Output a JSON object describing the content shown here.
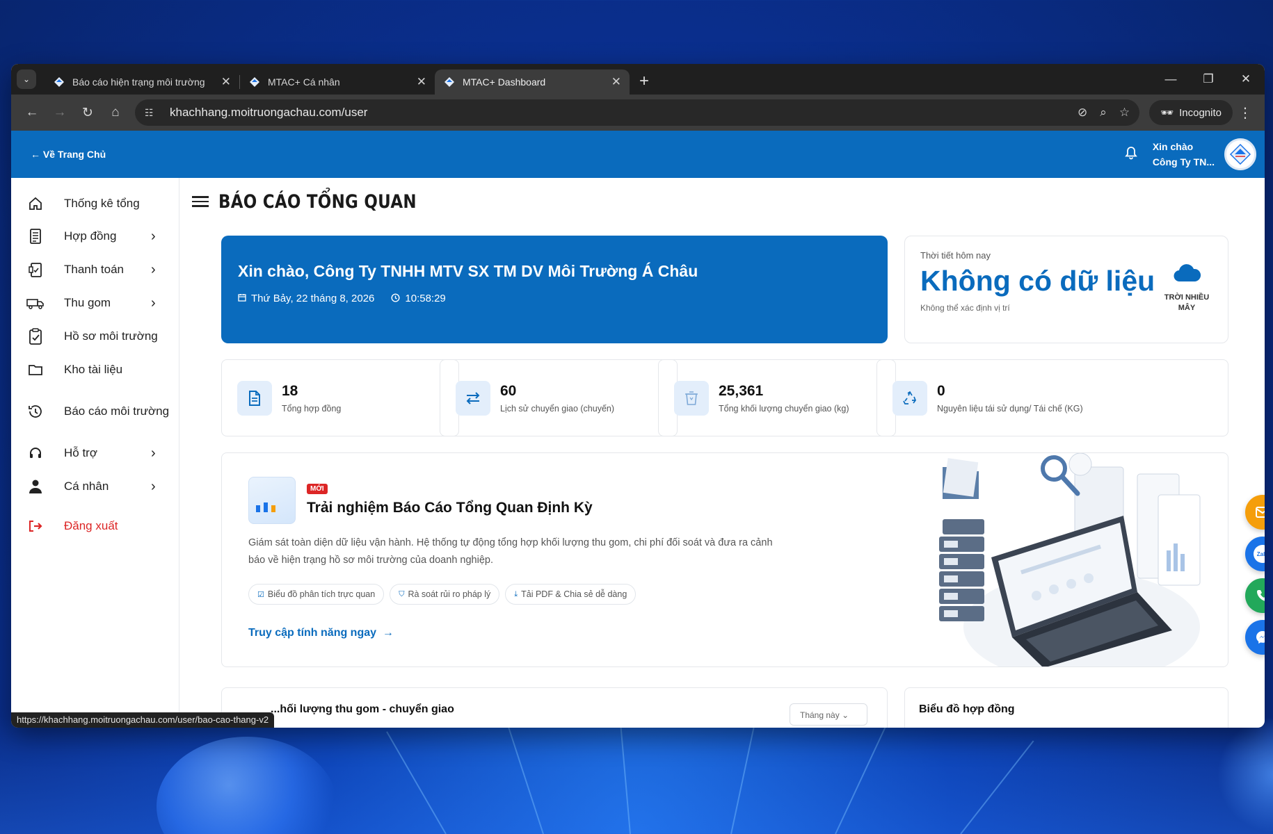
{
  "browser": {
    "tabs": [
      {
        "title": "Báo cáo hiện trạng môi trường",
        "active": false
      },
      {
        "title": "MTAC+ Cá nhân",
        "active": false
      },
      {
        "title": "MTAC+ Dashboard",
        "active": true
      }
    ],
    "url": "khachhang.moitruongachau.com/user",
    "incognito_label": "Incognito",
    "status_url": "https://khachhang.moitruongachau.com/user/bao-cao-thang-v2"
  },
  "header": {
    "back_label": "← Về Trang Chủ",
    "greeting_line1": "Xin chào",
    "greeting_line2": "Công Ty TN..."
  },
  "sidebar": {
    "items": [
      {
        "label": "Thống kê tổng",
        "icon": "home-icon",
        "has_chevron": false
      },
      {
        "label": "Hợp đồng",
        "icon": "document-icon",
        "has_chevron": true
      },
      {
        "label": "Thanh toán",
        "icon": "payment-icon",
        "has_chevron": true
      },
      {
        "label": "Thu gom",
        "icon": "truck-icon",
        "has_chevron": true
      },
      {
        "label": "Hồ sơ môi trường",
        "icon": "clipboard-check-icon",
        "has_chevron": false
      },
      {
        "label": "Kho tài liệu",
        "icon": "folder-icon",
        "has_chevron": false
      },
      {
        "label": "Báo cáo môi trường",
        "icon": "history-icon",
        "has_chevron": false
      },
      {
        "label": "Hỗ trợ",
        "icon": "headset-icon",
        "has_chevron": true
      },
      {
        "label": "Cá nhân",
        "icon": "user-icon",
        "has_chevron": true
      },
      {
        "label": "Đăng xuất",
        "icon": "logout-icon",
        "has_chevron": false
      }
    ]
  },
  "page": {
    "title": "BÁO CÁO TỔNG QUAN"
  },
  "hero": {
    "greeting": "Xin chào, Công Ty TNHH MTV SX TM DV Môi Trường Á Châu",
    "date": "Thứ Bảy, 22 tháng 8, 2026",
    "time": "10:58:29"
  },
  "weather": {
    "label": "Thời tiết hôm nay",
    "value": "Không có dữ liệu",
    "subtext": "Không thể xác định vị trí",
    "condition": "TRỜI NHIỀU MÂY"
  },
  "stats": [
    {
      "value": "18",
      "label": "Tổng hợp đồng",
      "icon": "file-icon"
    },
    {
      "value": "60",
      "label": "Lịch sử chuyển giao (chuyến)",
      "icon": "transfer-icon"
    },
    {
      "value": "25,361",
      "label": "Tổng khối lượng chuyển giao (kg)",
      "icon": "waste-bin-icon"
    },
    {
      "value": "0",
      "label": "Nguyên liệu tái sử dụng/ Tái chế (KG)",
      "icon": "recycle-icon"
    }
  ],
  "promo": {
    "badge": "MỚI",
    "title": "Trải nghiệm Báo Cáo Tổng Quan Định Kỳ",
    "description": "Giám sát toàn diện dữ liệu vận hành. Hệ thống tự động tổng hợp khối lượng thu gom, chi phí đối soát và đưa ra cảnh báo về hiện trạng hồ sơ môi trường của doanh nghiệp.",
    "chips": [
      "Biểu đồ phân tích trực quan",
      "Rà soát rủi ro pháp lý",
      "Tải PDF & Chia sẻ dễ dàng"
    ],
    "cta": "Truy cập tính năng ngay"
  },
  "bottom": {
    "left_title": "...hối lượng thu gom - chuyển giao",
    "left_select": "Tháng này",
    "right_title": "Biểu đồ hợp đồng"
  },
  "colors": {
    "primary": "#0a6bbd",
    "danger": "#dc2626",
    "fab_mail": "#f59e0b",
    "fab_zalo": "#1a73e8",
    "fab_phone": "#22a85a",
    "fab_messenger": "#1a73e8"
  }
}
